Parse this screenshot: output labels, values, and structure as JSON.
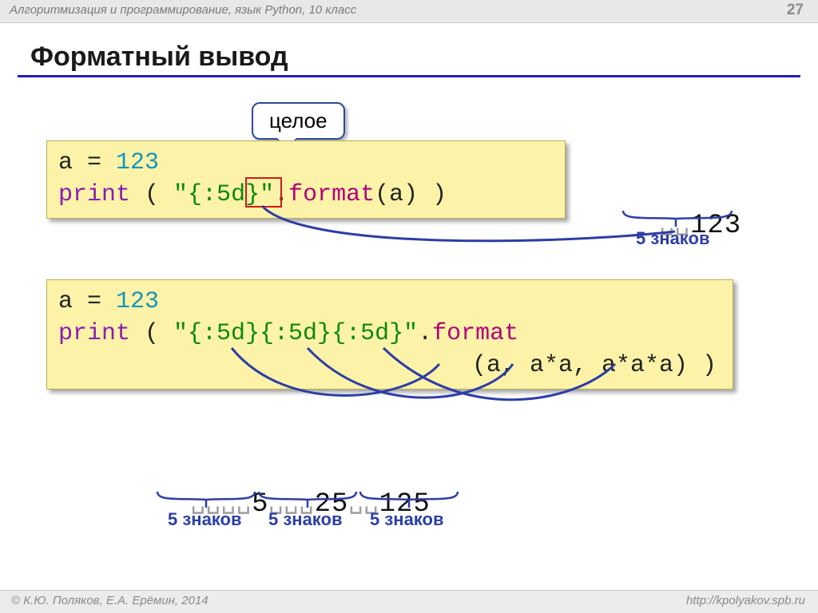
{
  "page": {
    "breadcrumb": "Алгоритмизация и программирование, язык Python, 10 класс",
    "number": "27",
    "title": "Форматный вывод"
  },
  "callout": {
    "label": "целое"
  },
  "code1": {
    "line1": {
      "var": "a",
      "eq": " = ",
      "num": "123"
    },
    "line2": {
      "kw": "print",
      "open": " ( ",
      "str_open": "\"{:",
      "n": "5",
      "str_close": "d}\"",
      "dot": ".",
      "fn": "format",
      "args": "(a) )"
    }
  },
  "out1": {
    "pad": "␣␣",
    "value": "123",
    "label": "5 знаков"
  },
  "code2": {
    "line1": {
      "var": "a",
      "eq": " = ",
      "num": "123"
    },
    "line2": {
      "kw": "print",
      "open": " ( ",
      "str": "\"{:5d}{:5d}{:5d}\"",
      "dot": ".",
      "fn": "format"
    },
    "line3": {
      "args": "(a, a*a, a*a*a) )"
    }
  },
  "out2": {
    "g1": {
      "pad": "␣␣␣␣",
      "value": "5"
    },
    "g2": {
      "pad": "␣␣␣",
      "value": "25"
    },
    "g3": {
      "pad": "␣␣",
      "value": "125"
    },
    "label": "5 знаков"
  },
  "footer": {
    "copyright": "© К.Ю. Поляков, Е.А. Ерёмин, 2014",
    "url": "http://kpolyakov.spb.ru"
  }
}
